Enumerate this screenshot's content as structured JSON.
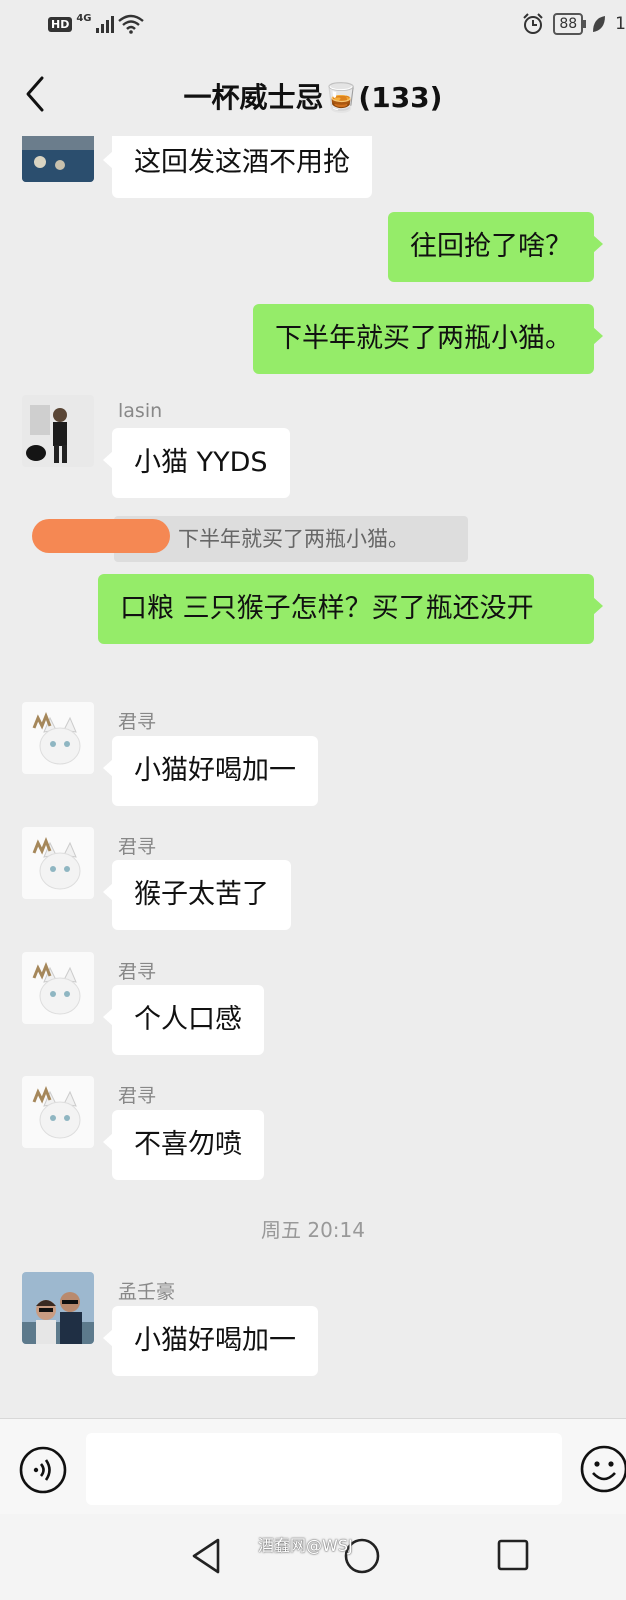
{
  "status_bar": {
    "hd": "HD",
    "network": "4G",
    "battery": "88",
    "battery_level_partial": "1"
  },
  "header": {
    "title": "一杯威士忌🥃(133)"
  },
  "messages": [
    {
      "side": "in",
      "sender": "",
      "text": "这回发这酒不用抢"
    },
    {
      "side": "out",
      "text": "往回抢了啥？"
    },
    {
      "side": "out",
      "text": "下半年就买了两瓶小猫。"
    },
    {
      "side": "in",
      "sender": "lasin",
      "text": "小猫 YYDS"
    },
    {
      "side": "quote",
      "text": "下半年就买了两瓶小猫。"
    },
    {
      "side": "out",
      "text": "口粮  三只猴子怎样？买了瓶还没开"
    },
    {
      "side": "in",
      "sender": "君寻",
      "text": "小猫好喝加一"
    },
    {
      "side": "in",
      "sender": "君寻",
      "text": "猴子太苦了"
    },
    {
      "side": "in",
      "sender": "君寻",
      "text": "个人口感"
    },
    {
      "side": "in",
      "sender": "君寻",
      "text": "不喜勿喷"
    },
    {
      "side": "time",
      "text": "周五 20:14"
    },
    {
      "side": "in",
      "sender": "孟壬豪",
      "text": "小猫好喝加一"
    }
  ],
  "input": {
    "value": "",
    "placeholder": ""
  },
  "watermark": "酒蠢网@WSJ",
  "colors": {
    "outgoing_bubble": "#95ec69",
    "incoming_bubble": "#ffffff",
    "background": "#ededed"
  }
}
